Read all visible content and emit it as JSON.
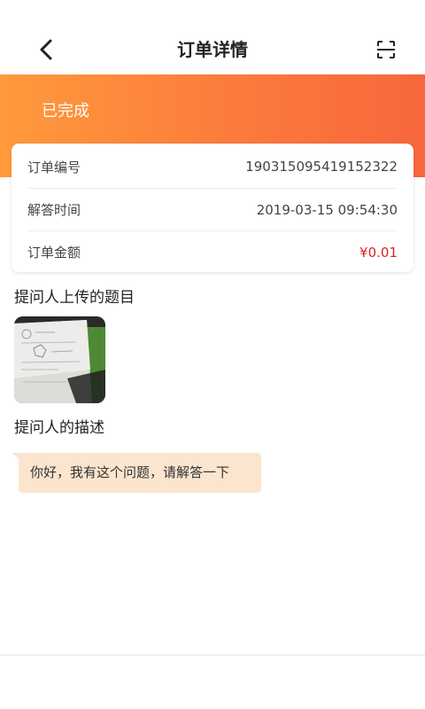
{
  "header": {
    "title": "订单详情",
    "back_icon": "chevron-left-icon",
    "scan_icon": "scan-icon"
  },
  "banner": {
    "status": "已完成",
    "gradient_start": "#ff9a3c",
    "gradient_end": "#f8663d"
  },
  "order": {
    "rows": [
      {
        "label": "订单编号",
        "value": "19031509541915232​2"
      },
      {
        "label": "解答时间",
        "value": "2019-03-15 09:54:30"
      },
      {
        "label": "订单金额",
        "value": "¥0.01"
      }
    ],
    "amount_color": "#e02020"
  },
  "question": {
    "uploaded_title": "提问人上传的题目",
    "description_title": "提问人的描述",
    "description_text": "你好，我有这个问题，请解答一下"
  }
}
